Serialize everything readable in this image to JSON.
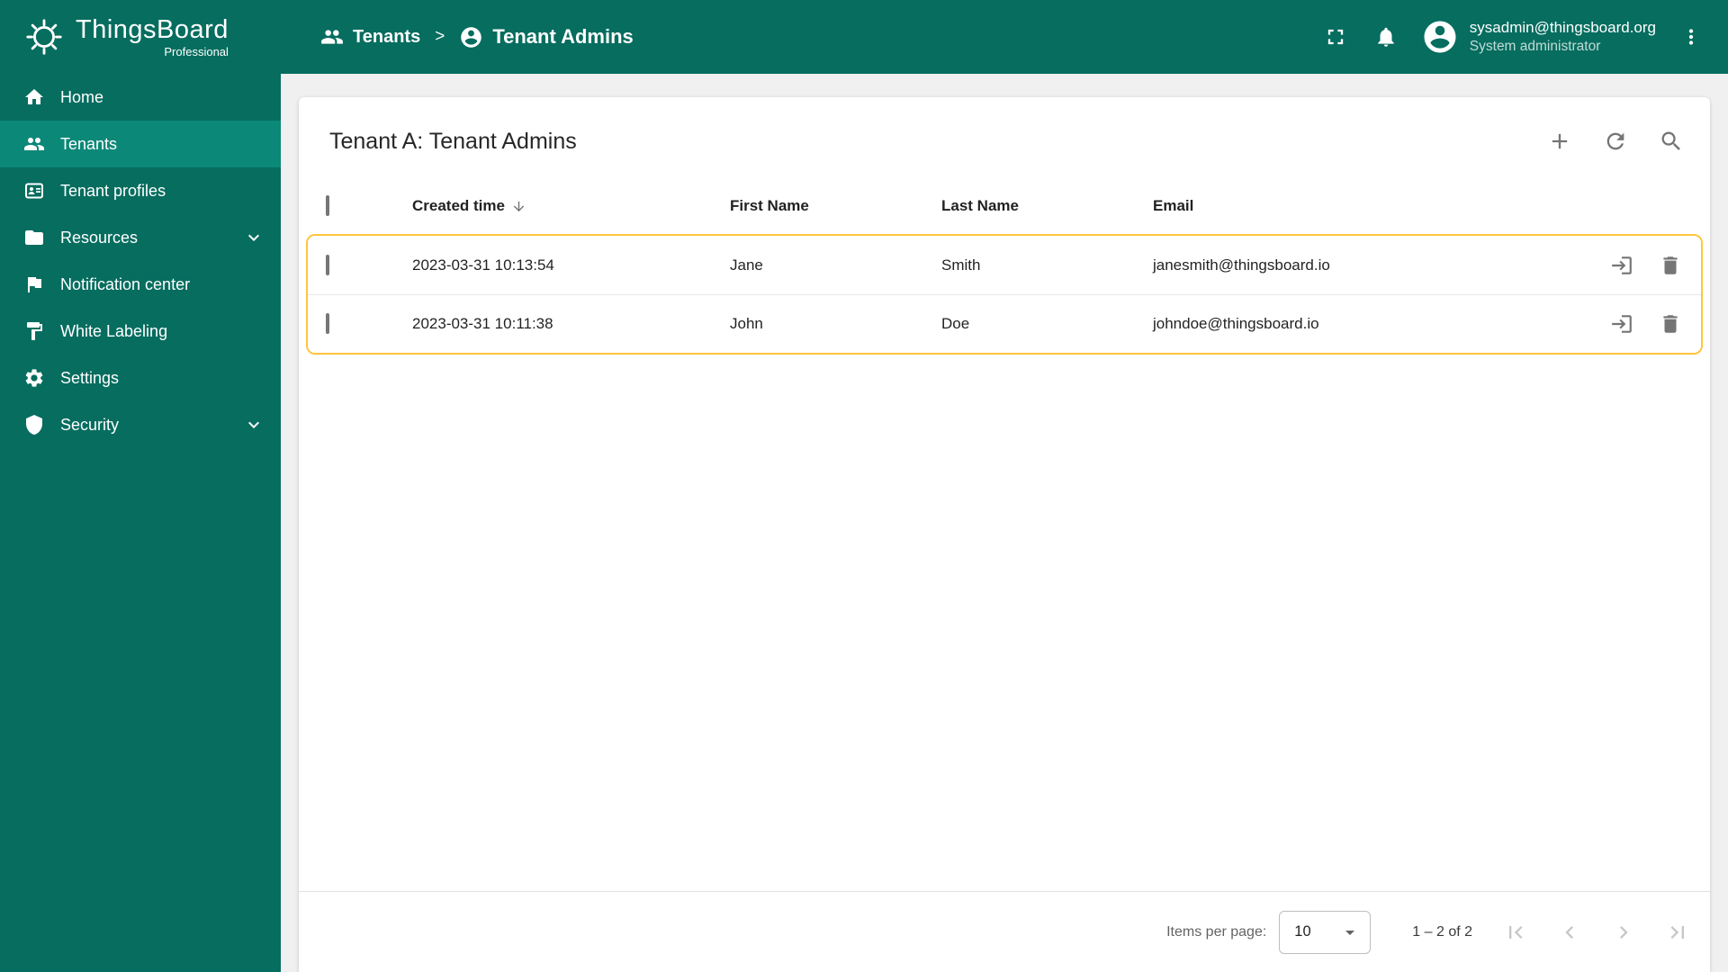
{
  "app": {
    "brand": "ThingsBoard",
    "brand_tagline": "Professional"
  },
  "header": {
    "breadcrumb": [
      {
        "label": "Tenants"
      },
      {
        "label": "Tenant Admins"
      }
    ],
    "separator": ">",
    "user": {
      "email": "sysadmin@thingsboard.org",
      "role": "System administrator"
    }
  },
  "sidebar": {
    "items": [
      {
        "label": "Home",
        "icon": "home-icon",
        "active": false,
        "expandable": false
      },
      {
        "label": "Tenants",
        "icon": "people-icon",
        "active": true,
        "expandable": false
      },
      {
        "label": "Tenant profiles",
        "icon": "badge-icon",
        "active": false,
        "expandable": false
      },
      {
        "label": "Resources",
        "icon": "folder-icon",
        "active": false,
        "expandable": true
      },
      {
        "label": "Notification center",
        "icon": "flag-icon",
        "active": false,
        "expandable": false
      },
      {
        "label": "White Labeling",
        "icon": "paint-roller-icon",
        "active": false,
        "expandable": false
      },
      {
        "label": "Settings",
        "icon": "gear-icon",
        "active": false,
        "expandable": false
      },
      {
        "label": "Security",
        "icon": "shield-icon",
        "active": false,
        "expandable": true
      }
    ]
  },
  "main": {
    "title": "Tenant A: Tenant Admins",
    "table": {
      "columns": [
        "Created time",
        "First Name",
        "Last Name",
        "Email"
      ],
      "sorted_by": "Created time",
      "sort_direction": "desc",
      "rows": [
        {
          "created_time": "2023-03-31 10:13:54",
          "first_name": "Jane",
          "last_name": "Smith",
          "email": "janesmith@thingsboard.io"
        },
        {
          "created_time": "2023-03-31 10:11:38",
          "first_name": "John",
          "last_name": "Doe",
          "email": "johndoe@thingsboard.io"
        }
      ]
    },
    "pagination": {
      "items_per_page_label": "Items per page:",
      "items_per_page_value": "10",
      "range": "1 – 2 of 2"
    }
  },
  "colors": {
    "primary_teal": "#066d5f",
    "active_item_teal": "#0c8878",
    "highlight_amber": "#ffc53d",
    "content_bg": "#f0f0f0",
    "icon_gray": "#757575"
  },
  "icons": [
    "thingsboard-logo-icon",
    "people-icon",
    "account-circle-icon",
    "fullscreen-icon",
    "bell-icon",
    "more-vert-icon",
    "home-icon",
    "badge-icon",
    "folder-icon",
    "flag-icon",
    "paint-roller-icon",
    "gear-icon",
    "shield-icon",
    "chevron-down-icon",
    "add-icon",
    "refresh-icon",
    "search-icon",
    "sort-desc-arrow-icon",
    "checkbox",
    "login-icon",
    "trash-icon",
    "dropdown-arrow-icon",
    "first-page-icon",
    "prev-page-icon",
    "next-page-icon",
    "last-page-icon"
  ]
}
